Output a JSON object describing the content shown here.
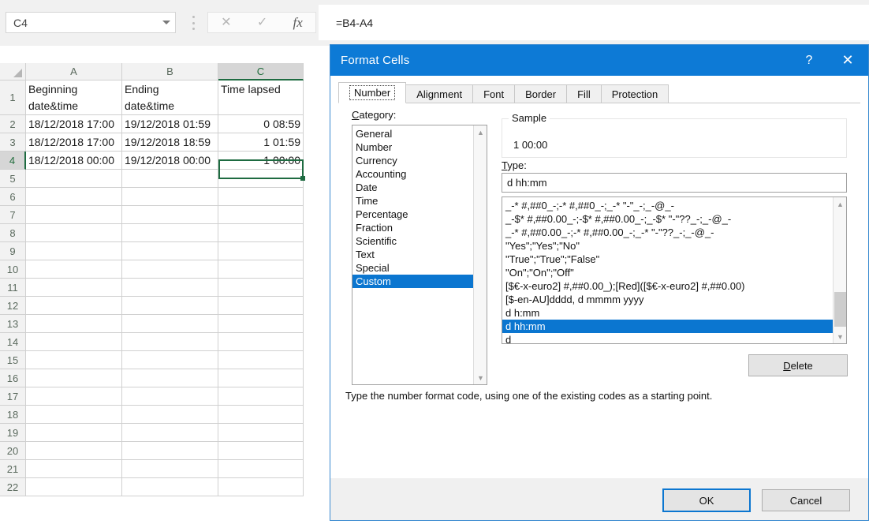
{
  "formula_bar": {
    "name_box_value": "C4",
    "name_box_dropdown_icon": "chevron-down-icon",
    "more_icon": "vertical-ellipsis-icon",
    "cancel_icon": "close-x-icon",
    "enter_icon": "check-icon",
    "function_icon": "fx-icon",
    "formula_value": "=B4-A4"
  },
  "grid": {
    "columns": [
      "A",
      "B",
      "C"
    ],
    "selected_column": "C",
    "selected_row": "4",
    "row_headers": [
      "1",
      "2",
      "3",
      "4",
      "5",
      "6",
      "7",
      "8",
      "9",
      "10",
      "11",
      "12",
      "13",
      "14",
      "15",
      "16",
      "17",
      "18",
      "19",
      "20",
      "21",
      "22"
    ],
    "rows": [
      {
        "num": "1",
        "a": "Beginning\ndate&time",
        "b": "Ending\ndate&time",
        "c": "Time lapsed"
      },
      {
        "num": "2",
        "a": "18/12/2018 17:00",
        "b": "19/12/2018 01:59",
        "c": "0 08:59"
      },
      {
        "num": "3",
        "a": "18/12/2018 17:00",
        "b": "19/12/2018 18:59",
        "c": "1 01:59"
      },
      {
        "num": "4",
        "a": "18/12/2018 00:00",
        "b": "19/12/2018 00:00",
        "c": "1 00:00"
      }
    ],
    "selected_cell": "C4"
  },
  "dialog": {
    "title": "Format Cells",
    "help_icon": "question-mark-icon",
    "close_icon": "close-x-icon",
    "tabs": [
      {
        "label": "Number",
        "active": true
      },
      {
        "label": "Alignment",
        "active": false
      },
      {
        "label": "Font",
        "active": false
      },
      {
        "label": "Border",
        "active": false
      },
      {
        "label": "Fill",
        "active": false
      },
      {
        "label": "Protection",
        "active": false
      }
    ],
    "category": {
      "label": "Category:",
      "label_accesskey": "C",
      "items": [
        "General",
        "Number",
        "Currency",
        "Accounting",
        "Date",
        "Time",
        "Percentage",
        "Fraction",
        "Scientific",
        "Text",
        "Special",
        "Custom"
      ],
      "selected": "Custom",
      "scroll_up_icon": "chevron-up-icon",
      "scroll_down_icon": "chevron-down-icon"
    },
    "sample": {
      "legend": "Sample",
      "value": "1 00:00"
    },
    "type": {
      "label": "Type:",
      "label_accesskey": "T",
      "value": "d hh:mm",
      "items": [
        "_-* #,##0_-;-* #,##0_-;_-* \"-\"_-;_-@_-",
        "_-$* #,##0.00_-;-$* #,##0.00_-;_-$* \"-\"??_-;_-@_-",
        "_-* #,##0.00_-;-* #,##0.00_-;_-* \"-\"??_-;_-@_-",
        "\"Yes\";\"Yes\";\"No\"",
        "\"True\";\"True\";\"False\"",
        "\"On\";\"On\";\"Off\"",
        "[$€-x-euro2] #,##0.00_);[Red]([$€-x-euro2] #,##0.00)",
        "[$-en-AU]dddd, d mmmm yyyy",
        "d h:mm",
        "d hh:mm",
        "d"
      ],
      "selected": "d hh:mm",
      "scroll_up_icon": "chevron-up-icon",
      "scroll_down_icon": "chevron-down-icon"
    },
    "delete_button": "Delete",
    "help_text": "Type the number format code, using one of the existing codes as a starting point.",
    "ok_button": "OK",
    "cancel_button": "Cancel"
  },
  "colors": {
    "title_bar": "#0d7ad6",
    "selection_blue": "#0b76d0",
    "excel_green": "#1e6b41"
  }
}
